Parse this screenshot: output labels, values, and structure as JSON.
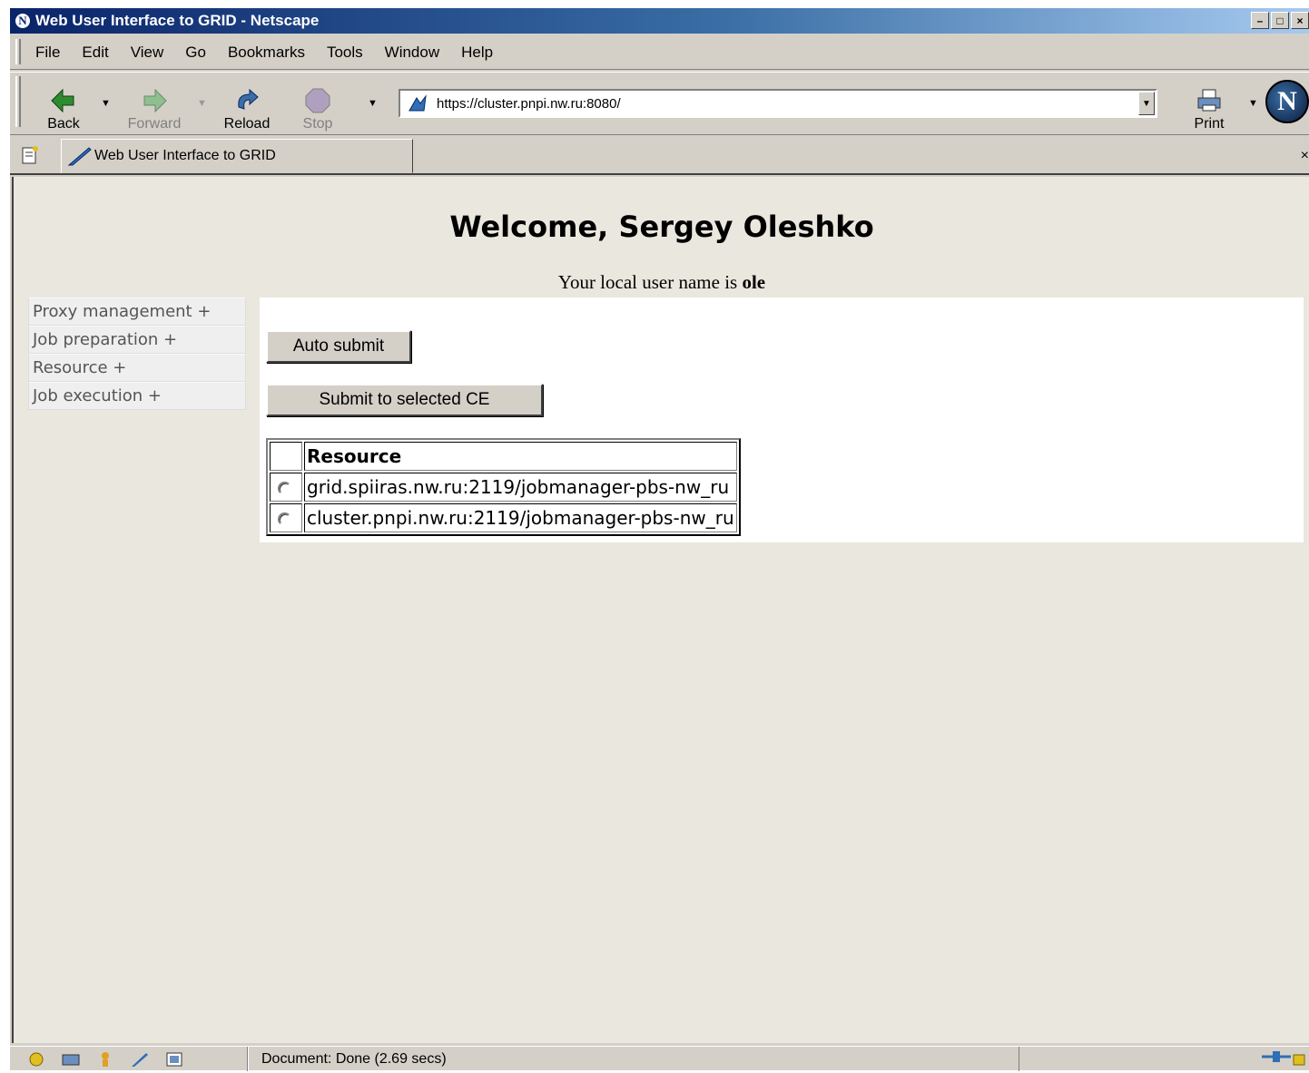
{
  "window": {
    "title": "Web User Interface to GRID - Netscape",
    "controls": [
      "minimize",
      "maximize",
      "close"
    ]
  },
  "menu": {
    "items": [
      {
        "label": "File"
      },
      {
        "label": "Edit"
      },
      {
        "label": "View"
      },
      {
        "label": "Go"
      },
      {
        "label": "Bookmarks"
      },
      {
        "label": "Tools"
      },
      {
        "label": "Window"
      },
      {
        "label": "Help"
      }
    ]
  },
  "toolbar": {
    "back_label": "Back",
    "forward_label": "Forward",
    "reload_label": "Reload",
    "stop_label": "Stop",
    "print_label": "Print",
    "url": "https://cluster.pnpi.nw.ru:8080/",
    "logo_letter": "N"
  },
  "tabs": {
    "active_label": "Web User Interface to GRID",
    "close_glyph": "×"
  },
  "page": {
    "welcome": "Welcome, Sergey Oleshko",
    "local_user_prefix": "Your local user name is",
    "local_user_name": "ole",
    "side_menu": [
      {
        "label": "Proxy management +"
      },
      {
        "label": "Job preparation +"
      },
      {
        "label": "Resource +"
      },
      {
        "label": "Job execution +"
      }
    ],
    "auto_submit_label": "Auto submit",
    "submit_selected_label": "Submit to selected CE",
    "table": {
      "header": "Resource",
      "rows": [
        {
          "resource": "grid.spiiras.nw.ru:2119/jobmanager-pbs-nw_ru",
          "selected": false
        },
        {
          "resource": "cluster.pnpi.nw.ru:2119/jobmanager-pbs-nw_ru",
          "selected": false
        }
      ]
    }
  },
  "status": {
    "text": "Document: Done (2.69 secs)"
  },
  "colors": {
    "titlebar": "#0a246a",
    "chrome": "#d4d0c8",
    "content_bg": "#eae7de",
    "panel_bg": "#ffffff"
  }
}
